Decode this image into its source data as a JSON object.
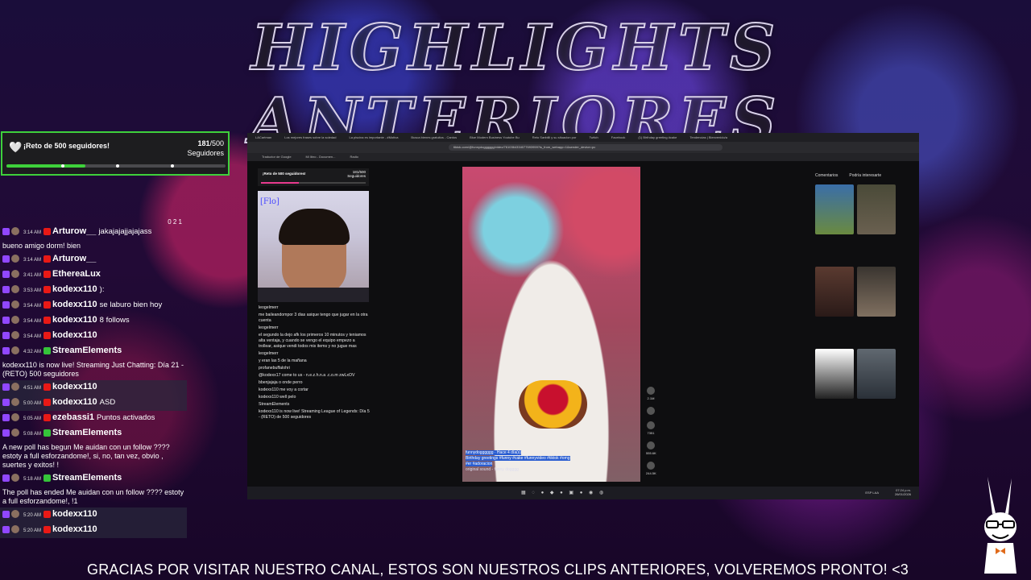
{
  "title": "HIGHLIGHTS ANTERIORES",
  "goal": {
    "label": "¡Reto de 500 seguidores!",
    "current": "181",
    "target": "/500",
    "unit": "Seguidores",
    "progress": 0.362
  },
  "chat": {
    "top_counts": "0  2  1",
    "messages": [
      {
        "type": "user",
        "time": "3:14 AM",
        "user": "Arturow__",
        "color": "#ffffff",
        "msg": "jakajajajjajajass",
        "hl": false
      },
      {
        "type": "sys",
        "text": "bueno amigo dorm! bien"
      },
      {
        "type": "user",
        "time": "3:14 AM",
        "user": "Arturow__",
        "color": "#ffffff",
        "msg": "",
        "hl": false
      },
      {
        "type": "user",
        "time": "3:41 AM",
        "user": "EtherеaLux",
        "color": "#ffffff",
        "msg": "",
        "hl": false
      },
      {
        "type": "user",
        "time": "3:53 AM",
        "user": "kodexx110",
        "color": "#ffffff",
        "msg": "):",
        "hl": false
      },
      {
        "type": "user",
        "time": "3:54 AM",
        "user": "kodexx110",
        "color": "#ffffff",
        "msg": "se laburo bien hoy",
        "hl": false
      },
      {
        "type": "user",
        "time": "3:54 AM",
        "user": "kodexx110",
        "color": "#ffffff",
        "msg": "8 follows",
        "hl": false
      },
      {
        "type": "user",
        "time": "3:54 AM",
        "user": "kodexx110",
        "color": "#ffffff",
        "msg": "",
        "hl": false
      },
      {
        "type": "user",
        "time": "4:32 AM",
        "user": "StreamElements",
        "color": "#ffffff",
        "msg": "",
        "hl": false
      },
      {
        "type": "sys",
        "text": "kodexx110 is now live! Streaming Just Chatting: Día 21 - (RETO) 500 seguidores"
      },
      {
        "type": "user",
        "time": "4:51 AM",
        "user": "kodexx110",
        "color": "#ffffff",
        "msg": "",
        "hl": true
      },
      {
        "type": "user",
        "time": "5:00 AM",
        "user": "kodexx110",
        "color": "#ffffff",
        "msg": "ASD",
        "hl": true
      },
      {
        "type": "user",
        "time": "5:05 AM",
        "user": "ezebassi1",
        "color": "#ffffff",
        "msg": "Puntos activados",
        "hl": false
      },
      {
        "type": "user",
        "time": "5:08 AM",
        "user": "StreamElements",
        "color": "#ffffff",
        "msg": "",
        "hl": false
      },
      {
        "type": "sys",
        "text": "A new poll has begun Me auidan con un follow ???? estoty a full esforzandome!, si, no, tan vez, obvio , suertes y exitos! !"
      },
      {
        "type": "user",
        "time": "5:18 AM",
        "user": "StreamElements",
        "color": "#ffffff",
        "msg": "",
        "hl": false
      },
      {
        "type": "sys",
        "text": "The poll has ended Me auidan con un follow ???? estoty a full esforzandome!, !1"
      },
      {
        "type": "user",
        "time": "5:20 AM",
        "user": "kodexx110",
        "color": "#ffffff",
        "msg": "",
        "hl": true
      },
      {
        "type": "user",
        "time": "5:20 AM",
        "user": "kodexx110",
        "color": "#ffffff",
        "msg": "",
        "hl": true
      }
    ]
  },
  "screen": {
    "tabs": [
      "LACartman",
      "Los mejores frases sobre la soledad",
      "La piscina es importante - #Motiva",
      "Busca bienes gratuitos - Cantos",
      "Blue Modern Business Youtube Bu",
      "Reto Sanbilli y su situacion por",
      "Twitch",
      "Facebook",
      "(1) Birthday greeting #cake",
      "Tendencias | Bienvenido/a"
    ],
    "url": "tiktok.com/@funnydogggggg/video/7610364334077693959?is_from_webapp=1&sender_device=pc",
    "bookmarks": [
      "Traductor de Google",
      "Mi libro - Documen...",
      "Radio"
    ],
    "inner_goal_label": "¡Reto de 500 seguidores!",
    "inner_goal_count": "181/500",
    "inner_goal_unit": "Seguidores",
    "webcam_tag": "[Flo]",
    "inner_chat": [
      "leogelmerr",
      "me baileandompor 3 dias asique tengo que jugar en la otra cuenta",
      "leogelmerr",
      "el segundo la dejo afk los primeros 10 minutos y teniamos alta ventaja, y cuando se vengo el equipo empezo a trollear, asique vendi todos mis items y no jugue mas",
      "leogelmerr",
      "y eran las 5 de la mañana",
      "profanebuffalohri",
      "@kodexx17 come to us - n.e.z.h.n.a .c.o.m zwLxOV",
      "bbenjajaja  o onde perro",
      "kodexx110  me voy a cortar",
      "kodexx110  well pelo",
      "StreamElements",
      "kodexx110 is now live! Streaming League of Legends: Día 5 - (RETO) de 500 seguidores"
    ],
    "video_caption_user": "funnydogggggg · Hace 4 día(s)",
    "video_caption": "Birthday greetings #funny #cake #funnyvideo #tiktok #omg",
    "video_caption2": "#er #adoracion",
    "video_sound": "original sound - funny dogggg",
    "rail_counts": [
      "2.1M",
      "",
      "7351",
      "555.6K",
      "244.5K"
    ],
    "side_tabs": [
      "Comentarios",
      "Podría interesarte"
    ],
    "taskbar_time": "07:24 p.m.",
    "taskbar_date": "26/01/2026",
    "taskbar_lang": "ESP LAA"
  },
  "footer": "GRACIAS POR VISITAR NUESTRO CANAL, ESTOS SON NUESTROS CLIPS ANTERIORES, VOLVEREMOS PRONTO!  <3",
  "colors": {
    "goal_accent": "#3ed13b",
    "twitch_purple": "#9147ff"
  }
}
